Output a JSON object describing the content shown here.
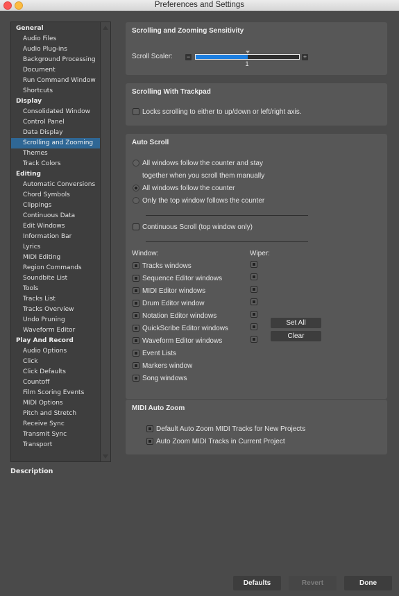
{
  "window": {
    "title": "Preferences and Settings",
    "controls": [
      "close",
      "minimize"
    ]
  },
  "sidebar": {
    "selected": "Scrolling and Zooming",
    "groups": [
      {
        "label": "General",
        "items": [
          "Audio Files",
          "Audio Plug-ins",
          "Background Processing",
          "Document",
          "Run Command Window",
          "Shortcuts"
        ]
      },
      {
        "label": "Display",
        "items": [
          "Consolidated Window",
          "Control Panel",
          "Data Display",
          "Scrolling and Zooming",
          "Themes",
          "Track Colors"
        ]
      },
      {
        "label": "Editing",
        "items": [
          "Automatic Conversions",
          "Chord Symbols",
          "Clippings",
          "Continuous Data",
          "Edit Windows",
          "Information Bar",
          "Lyrics",
          "MIDI Editing",
          "Region Commands",
          "Soundbite List",
          "Tools",
          "Tracks List",
          "Tracks Overview",
          "Undo Pruning",
          "Waveform Editor"
        ]
      },
      {
        "label": "Play And Record",
        "items": [
          "Audio Options",
          "Click",
          "Click Defaults",
          "Countoff",
          "Film Scoring Events",
          "MIDI Options",
          "Pitch and Stretch",
          "Receive Sync",
          "Transmit Sync",
          "Transport"
        ]
      }
    ],
    "description_label": "Description"
  },
  "sensitivity": {
    "title": "Scrolling and Zooming Sensitivity",
    "scaler_label": "Scroll Scaler:",
    "minus": "−",
    "plus": "+",
    "value_label": "1",
    "fill_fraction": 0.5
  },
  "trackpad": {
    "title": "Scrolling With Trackpad",
    "lock_label": "Locks scrolling to either to up/down or left/right axis.",
    "lock_checked": false
  },
  "autoscroll": {
    "title": "Auto Scroll",
    "options": [
      {
        "line1": "All windows follow the counter and stay",
        "line2": "together when you scroll them manually",
        "selected": false
      },
      {
        "line1": "All windows follow the counter",
        "selected": true
      },
      {
        "line1": "Only the top window follows the counter",
        "selected": false
      }
    ],
    "continuous_label": "Continuous Scroll (top window only)",
    "continuous_checked": false,
    "window_header": "Window:",
    "wiper_header": "Wiper:",
    "windows": [
      {
        "label": "Tracks windows",
        "checked": true,
        "wiper": true
      },
      {
        "label": "Sequence Editor windows",
        "checked": true,
        "wiper": true
      },
      {
        "label": "MIDI Editor windows",
        "checked": true,
        "wiper": true
      },
      {
        "label": "Drum Editor window",
        "checked": true,
        "wiper": true
      },
      {
        "label": "Notation Editor windows",
        "checked": true,
        "wiper": true
      },
      {
        "label": "QuickScribe Editor windows",
        "checked": true,
        "wiper": true
      },
      {
        "label": "Waveform Editor windows",
        "checked": true,
        "wiper": true
      },
      {
        "label": "Event Lists",
        "checked": true
      },
      {
        "label": "Markers window",
        "checked": true
      },
      {
        "label": "Song windows",
        "checked": true
      }
    ],
    "set_all_label": "Set All",
    "clear_label": "Clear"
  },
  "midi_zoom": {
    "title": "MIDI Auto Zoom",
    "options": [
      {
        "label": "Default Auto Zoom MIDI Tracks for New Projects",
        "checked": true
      },
      {
        "label": "Auto Zoom MIDI Tracks in Current Project",
        "checked": true
      }
    ]
  },
  "footer": {
    "defaults_label": "Defaults",
    "revert_label": "Revert",
    "done_label": "Done"
  }
}
